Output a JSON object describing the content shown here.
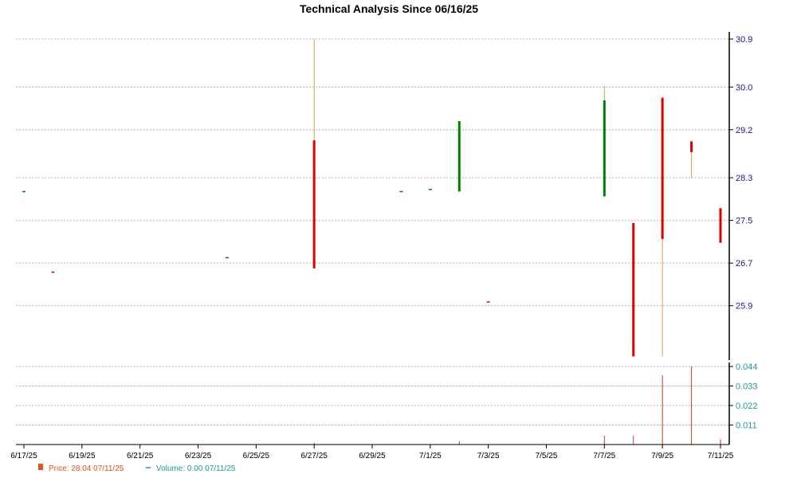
{
  "chart_data": {
    "type": "candlestick",
    "title": "Technical Analysis Since 06/16/25",
    "y_ticks": [
      "30.9",
      "30.0",
      "29.2",
      "28.3",
      "27.5",
      "26.7",
      "25.9"
    ],
    "y_tick_values": [
      30.9,
      30.0,
      29.2,
      28.3,
      27.5,
      26.7,
      25.9
    ],
    "ylim": [
      25.0,
      30.9
    ],
    "x_ticks": [
      "6/17/25",
      "6/19/25",
      "6/21/25",
      "6/23/25",
      "6/25/25",
      "6/27/25",
      "6/29/25",
      "7/1/25",
      "7/3/25",
      "7/5/25",
      "7/7/25",
      "7/9/25",
      "7/11/25"
    ],
    "x_tick_days": [
      1,
      3,
      5,
      7,
      9,
      11,
      13,
      15,
      17,
      19,
      21,
      23,
      25
    ],
    "xlim_days": [
      1,
      25
    ],
    "candles": [
      {
        "day": 1,
        "open": 28.04,
        "close": 28.04,
        "high": 28.04,
        "low": 28.04,
        "color": "#008000"
      },
      {
        "day": 2,
        "open": 26.53,
        "close": 26.53,
        "high": 26.53,
        "low": 26.53,
        "color": "#e00000"
      },
      {
        "day": 8,
        "open": 26.8,
        "close": 26.8,
        "high": 26.8,
        "low": 26.8,
        "color": "#008000"
      },
      {
        "day": 11,
        "open": 29.0,
        "close": 26.6,
        "high": 30.9,
        "low": 26.6,
        "color": "#e00000"
      },
      {
        "day": 14,
        "open": 28.04,
        "close": 28.04,
        "high": 28.04,
        "low": 28.04,
        "color": "#008000"
      },
      {
        "day": 15,
        "open": 28.08,
        "close": 28.08,
        "high": 28.08,
        "low": 28.08,
        "color": "#008000"
      },
      {
        "day": 16,
        "open": 28.04,
        "close": 29.36,
        "high": 29.36,
        "low": 28.04,
        "color": "#008000"
      },
      {
        "day": 17,
        "open": 25.97,
        "close": 25.97,
        "high": 25.97,
        "low": 25.97,
        "color": "#e00000"
      },
      {
        "day": 21,
        "open": 27.95,
        "close": 29.75,
        "high": 30.02,
        "low": 27.95,
        "color": "#008000"
      },
      {
        "day": 22,
        "open": 27.45,
        "close": 24.95,
        "high": 27.45,
        "low": 24.95,
        "color": "#e00000"
      },
      {
        "day": 23,
        "open": 29.8,
        "close": 27.15,
        "high": 29.8,
        "low": 24.95,
        "color": "#e00000"
      },
      {
        "day": 24,
        "open": 28.98,
        "close": 28.78,
        "high": 28.98,
        "low": 28.3,
        "color": "#e00000"
      },
      {
        "day": 25,
        "open": 27.73,
        "close": 27.08,
        "high": 27.73,
        "low": 27.08,
        "color": "#e00000"
      }
    ],
    "volume_ticks": [
      "0.044",
      "0.033",
      "0.022",
      "0.011"
    ],
    "volume_tick_values": [
      0.044,
      0.033,
      0.022,
      0.011
    ],
    "volume_ylim": [
      0,
      0.044
    ],
    "volume_bars": [
      {
        "day": 11,
        "value": 0.001
      },
      {
        "day": 16,
        "value": 0.002
      },
      {
        "day": 21,
        "value": 0.005
      },
      {
        "day": 22,
        "value": 0.005
      },
      {
        "day": 23,
        "value": 0.039
      },
      {
        "day": 24,
        "value": 0.044
      },
      {
        "day": 25,
        "value": 0.003
      }
    ],
    "legend": {
      "price_label": "Price: 28.04  07/11/25",
      "volume_label": "Volume: 0.00  07/11/25"
    },
    "colors": {
      "up": "#008000",
      "down": "#e00000",
      "wick": "#d9a050",
      "volume": "#c0392b",
      "price_axis_text": "#1a1a8c",
      "volume_axis_text": "#1a9aa0",
      "legend_price": "#e2541a"
    }
  }
}
